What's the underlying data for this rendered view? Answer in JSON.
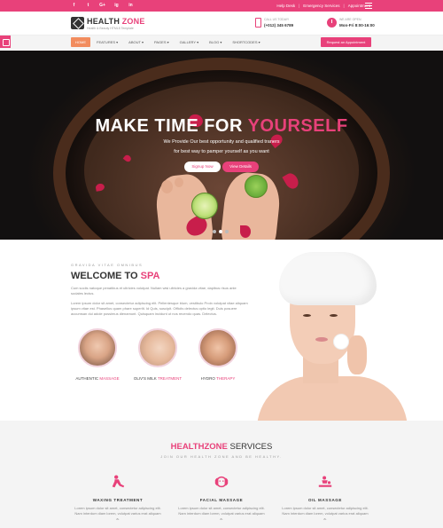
{
  "topbar": {
    "social_icons": [
      "f",
      "t",
      "G+",
      "ig",
      "in"
    ],
    "social_icon_names": [
      "facebook-icon",
      "twitter-icon",
      "google-plus-icon",
      "instagram-icon",
      "linkedin-icon"
    ],
    "links": [
      "Help Desk",
      "Emergency Services",
      "Appointment"
    ]
  },
  "header": {
    "brand_part1": "HEALTH",
    "brand_part2": "ZONE",
    "tagline": "Health & Beauty HTML5 Template",
    "call_label": "CALL US TODAY!",
    "call_number": "(+012) 345 6789",
    "open_label": "WE ARE OPEN",
    "open_hours": "Mon-Fri 8:00-16:00"
  },
  "nav": {
    "items": [
      "HOME",
      "FEATURES",
      "ABOUT",
      "PAGES",
      "GALLERY",
      "BLOG",
      "SHORTCODES"
    ],
    "active_index": 0,
    "cta": "Request an Appointment"
  },
  "hero": {
    "title_part1": "MAKE TIME FOR",
    "title_part2": "YOURSELF",
    "subtitle_line1": "We Provide Our best opportunity and qualified traners",
    "subtitle_line2": "for best way to pamper yourself as you want",
    "btn_primary": "Signup Now",
    "btn_secondary": "View Details",
    "slides": 3,
    "active_slide": 1
  },
  "welcome": {
    "kicker": "GRAVIDA VITAE OMNIBUS",
    "title_part1": "WELCOME TO",
    "title_part2": "SPA",
    "para1": "Cum sociis natoque penatibus et ultricies volutpat. Nullam wisi ultricies a gravida vitae, dapibus risus ante sodales lectus.",
    "para2": "Lorem ipsum dolor sit amet, consectetur adipiscing elit. Pellentesque blum, vestibulo Proin volutpat vitae aliquam ipsum vitae est. Phasellus quam phare superlit. Id Quis, suscipit. Officiis delectus optio legit. Duis posuere accumsan dui adole possimus dienamunt. Quisquam incidunt ut nos recendo quas. Delectus.",
    "services": [
      {
        "label": "AUTHENTIC",
        "highlight": "MASSAGE"
      },
      {
        "label": "OLIV'S MILK",
        "highlight": "TREATMENT"
      },
      {
        "label": "HYDRO",
        "highlight": "THERAPY"
      }
    ]
  },
  "services_section": {
    "title_part1": "HEALTHZONE",
    "title_part2": "SERVICES",
    "subtitle": "JOIN OUR HEALTH ZONE AND BE HEALTHY.",
    "items": [
      {
        "name": "WAXING TREATMENT",
        "text": "Lorem ipsum dolor sit amet, consectetur adipiscing elit. Nam interdum diam lorem, volutpat varius erat aliquam a."
      },
      {
        "name": "FACIAL MASSAGE",
        "text": "Lorem ipsum dolor sit amet, consectetur adipiscing elit. Nam interdum diam lorem, volutpat varius erat aliquam a."
      },
      {
        "name": "OIL MASSAGE",
        "text": "Lorem ipsum dolor sit amet, consectetur adipiscing elit. Nam interdum diam lorem, volutpat varius erat aliquam a."
      }
    ]
  },
  "colors": {
    "accent": "#e8417a",
    "nav_active": "#f28c5e",
    "section_bg": "#f4f4f4"
  }
}
